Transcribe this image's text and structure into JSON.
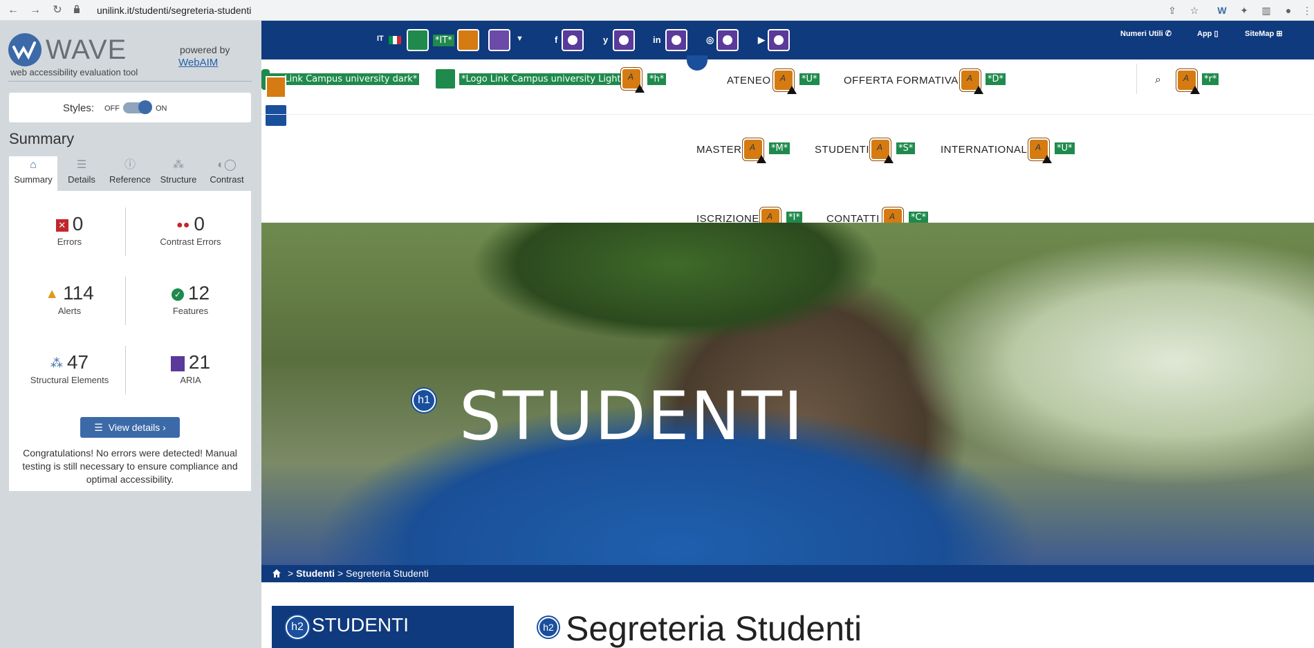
{
  "browser": {
    "url": "unilink.it/studenti/segreteria-studenti"
  },
  "wave": {
    "title": "WAVE",
    "subtitle": "web accessibility evaluation tool",
    "powered_by": "powered by",
    "webaim": "WebAIM",
    "styles_label": "Styles:",
    "styles_off": "OFF",
    "styles_on": "ON",
    "summary_heading": "Summary",
    "tabs": [
      {
        "label": "Summary",
        "icon": "home-icon"
      },
      {
        "label": "Details",
        "icon": "list-icon"
      },
      {
        "label": "Reference",
        "icon": "info-icon"
      },
      {
        "label": "Structure",
        "icon": "hierarchy-icon"
      },
      {
        "label": "Contrast",
        "icon": "contrast-icon"
      }
    ],
    "stats": {
      "errors": {
        "value": "0",
        "label": "Errors"
      },
      "contrast_errors": {
        "value": "0",
        "label": "Contrast Errors"
      },
      "alerts": {
        "value": "114",
        "label": "Alerts"
      },
      "features": {
        "value": "12",
        "label": "Features"
      },
      "structural": {
        "value": "47",
        "label": "Structural Elements"
      },
      "aria": {
        "value": "21",
        "label": "ARIA"
      }
    },
    "view_details": "View details ›",
    "congrats": "Congratulations! No errors were detected! Manual testing is still necessary to ensure compliance and optimal accessibility."
  },
  "site": {
    "lang": "IT",
    "lang_label": "*IT*",
    "social": [
      "f",
      "y",
      "in",
      "◎",
      "▶"
    ],
    "utility": [
      "Numeri Utili ✆",
      "App ▯",
      "SiteMap ⊞"
    ],
    "logo_dark": "go Link Campus university dark*",
    "logo_light": "*Logo Link Campus university Light*",
    "logo_h": "*h*",
    "nav": [
      {
        "label": "ATENEO",
        "tag": "*U*"
      },
      {
        "label": "OFFERTA FORMATIVA",
        "tag": "*D*"
      },
      {
        "label": "MASTER",
        "tag": "*M*"
      },
      {
        "label": "STUDENTI",
        "tag": "*S*"
      },
      {
        "label": "INTERNATIONAL",
        "tag": "*U*"
      },
      {
        "label": "ISCRIZIONE",
        "tag": "*I*"
      },
      {
        "label": "CONTATTI",
        "tag": "*C*"
      }
    ],
    "search_tag": "*r*",
    "hero_title": "STUDENTI",
    "h1": "h1",
    "breadcrumb": {
      "sep1": " > ",
      "studenti": "Studenti",
      "sep2": " > ",
      "current": "Segreteria Studenti"
    },
    "h2": "h2",
    "sidebar_title": "STUDENTI",
    "page_title": "Segreteria Studenti"
  }
}
